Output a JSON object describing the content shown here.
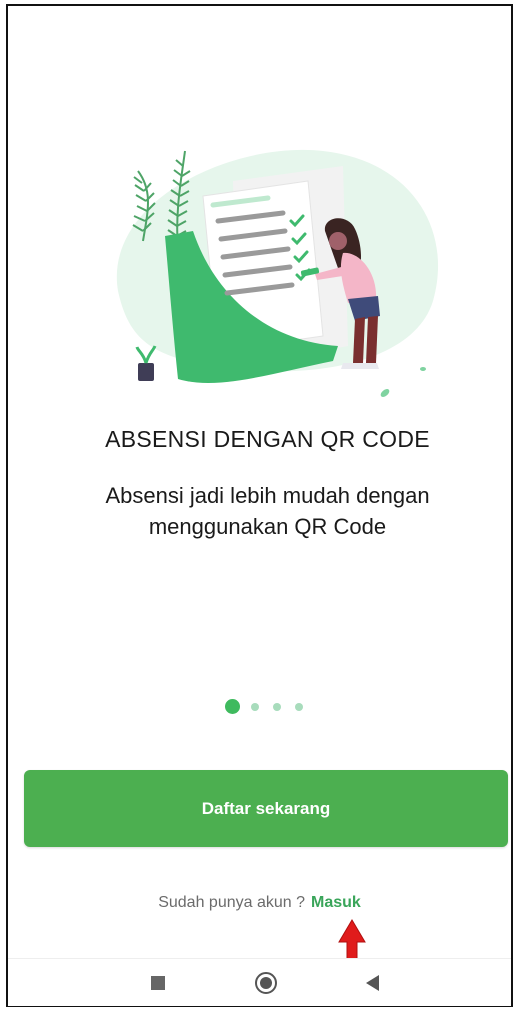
{
  "onboarding": {
    "title": "ABSENSI DENGAN QR CODE",
    "description": "Absensi jadi lebih mudah dengan menggunakan QR Code",
    "page_indicator": {
      "total": 4,
      "active": 1
    }
  },
  "actions": {
    "register_label": "Daftar sekarang",
    "login_prompt": "Sudah punya akun ?",
    "login_label": "Masuk"
  },
  "icons": {
    "illustration": "checklist-document-illustration",
    "annotation": "red-arrow-up-icon",
    "nav_recents": "square-icon",
    "nav_home": "circle-icon",
    "nav_back": "triangle-back-icon"
  },
  "colors": {
    "primary": "#4caf50",
    "link": "#3aa55a",
    "dot_active": "#3fba5e",
    "dot_inactive": "#a8dcbc",
    "annotation_arrow": "#e01b1b"
  }
}
